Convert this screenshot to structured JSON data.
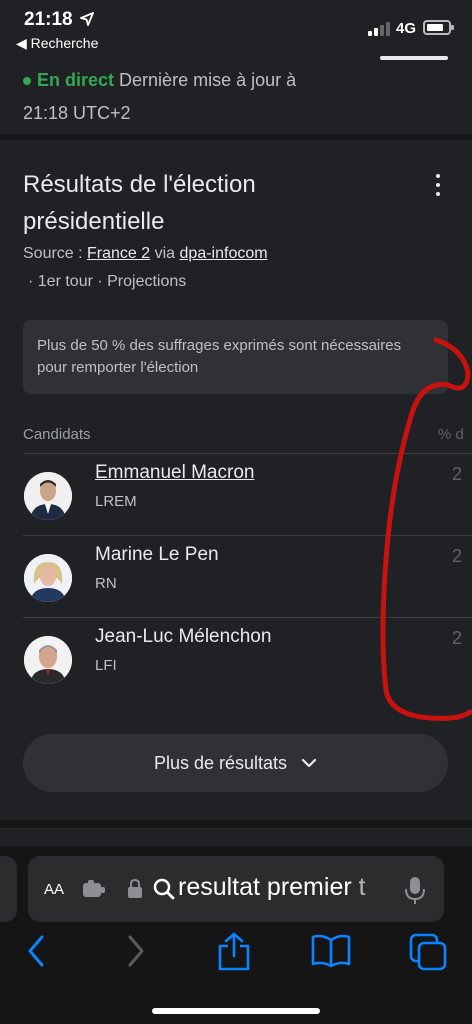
{
  "status_bar": {
    "time": "21:18",
    "back_label": "◀ Recherche",
    "network": "4G"
  },
  "live": {
    "label": "En direct",
    "text": "Dernière mise à jour à 21:18 UTC+2"
  },
  "card": {
    "title": "Résultats de l'élection présidentielle",
    "source_prefix": "Source : ",
    "source_name": "France 2",
    "source_via": " via ",
    "source_partner": "dpa-infocom",
    "meta": "· 1er tour · Projections",
    "notice": "Plus de 50 % des suffrages exprimés sont nécessaires pour remporter l'élection"
  },
  "table": {
    "header_left": "Candidats",
    "header_right": "% d",
    "candidates": [
      {
        "name": "Emmanuel Macron",
        "party": "LREM",
        "pct": "2"
      },
      {
        "name": "Marine Le Pen",
        "party": "RN",
        "pct": "2"
      },
      {
        "name": "Jean-Luc Mélenchon",
        "party": "LFI",
        "pct": "2"
      }
    ]
  },
  "more_button": {
    "label": "Plus de résultats"
  },
  "browser": {
    "text_size": "AA",
    "url_text": "resultat premier t"
  },
  "colors": {
    "background": "#202124",
    "live_green": "#34a853",
    "accent_blue": "#0a84ff",
    "annotation_red": "#c8120f"
  },
  "icons": [
    "location-arrow-icon",
    "signal-icon",
    "battery-icon",
    "more-vert-icon",
    "chevron-down-icon",
    "puzzle-icon",
    "lock-icon",
    "search-icon",
    "mic-icon",
    "back-icon",
    "forward-icon",
    "share-icon",
    "bookmarks-icon",
    "tabs-icon"
  ]
}
